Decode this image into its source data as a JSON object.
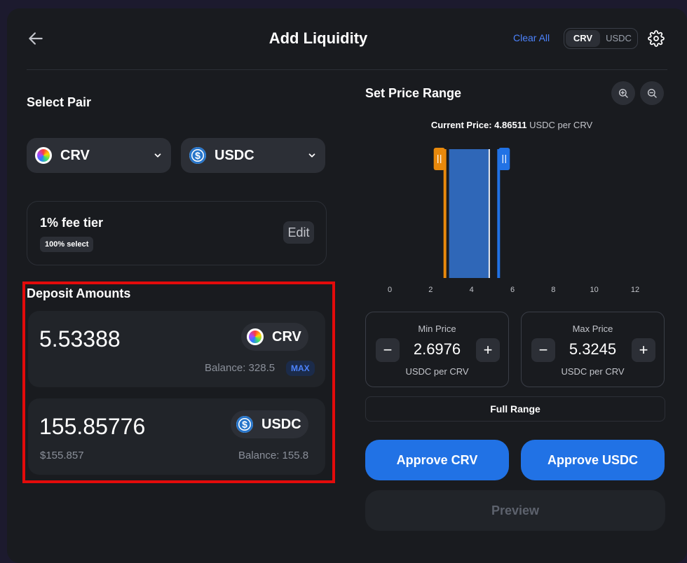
{
  "header": {
    "title": "Add Liquidity",
    "clear_all": "Clear All",
    "toggle": [
      "CRV",
      "USDC"
    ],
    "active_toggle": "CRV"
  },
  "select_pair": {
    "title": "Select Pair",
    "token_a": "CRV",
    "token_b": "USDC"
  },
  "fee": {
    "label": "1% fee tier",
    "badge": "100% select",
    "edit": "Edit"
  },
  "deposit": {
    "title": "Deposit Amounts",
    "token_a": {
      "amount": "5.53388",
      "symbol": "CRV",
      "balance": "Balance: 328.5",
      "max": "MAX"
    },
    "token_b": {
      "amount": "155.85776",
      "symbol": "USDC",
      "usd_value": "$155.857",
      "balance": "Balance: 155.8"
    }
  },
  "price_range": {
    "title": "Set Price Range",
    "current_label": "Current Price:",
    "current_value": "4.86511",
    "current_unit": "USDC per CRV",
    "min": {
      "label": "Min Price",
      "value": "2.6976",
      "unit": "USDC per CRV"
    },
    "max": {
      "label": "Max Price",
      "value": "5.3245",
      "unit": "USDC per CRV"
    },
    "full_range": "Full Range"
  },
  "chart_data": {
    "type": "area",
    "x_ticks": [
      "0",
      "2",
      "4",
      "6",
      "8",
      "10",
      "12"
    ],
    "xlim": [
      0,
      12
    ],
    "current_price": 4.86511,
    "range_min": 2.6976,
    "range_max": 5.3245,
    "liquidity_band": [
      2.9,
      4.9
    ]
  },
  "actions": {
    "approve_a": "Approve CRV",
    "approve_b": "Approve USDC",
    "preview": "Preview"
  },
  "colors": {
    "accent": "#2172e5",
    "min_handle": "#e8890c",
    "max_handle": "#2172e5",
    "highlight": "#e30b0b"
  }
}
